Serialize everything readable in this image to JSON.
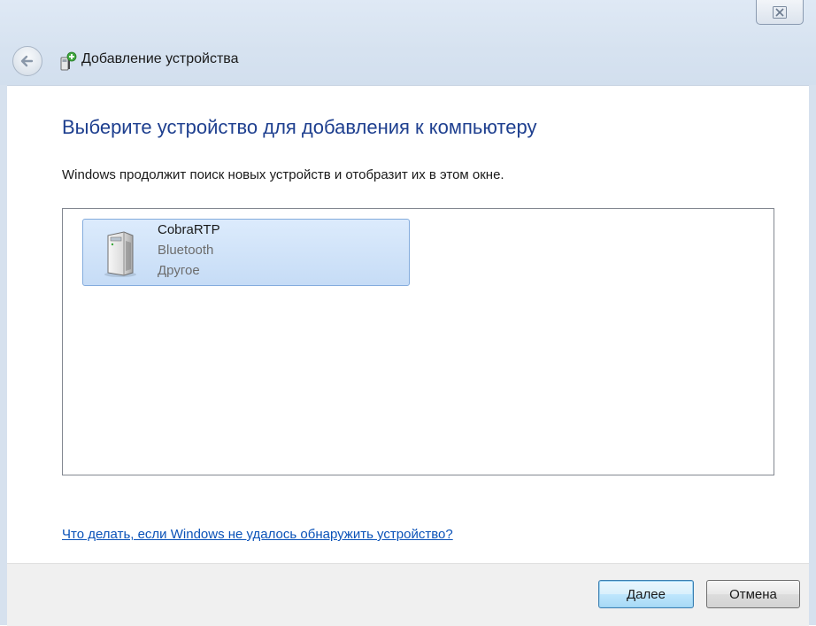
{
  "window": {
    "title": "Добавление устройства",
    "close_label": "☒"
  },
  "content": {
    "heading": "Выберите устройство для добавления к компьютеру",
    "subtext": "Windows продолжит поиск новых устройств и отобразит их в этом окне.",
    "devices": [
      {
        "name": "CobraRTP",
        "type": "Bluetooth",
        "category": "Другое",
        "icon": "device-tower-icon",
        "selected": true
      }
    ],
    "help_link": "Что делать, если Windows не удалось обнаружить устройство?"
  },
  "footer": {
    "next_label": "Далее",
    "cancel_label": "Отмена"
  },
  "colors": {
    "heading": "#1e3f8f",
    "link": "#0a52b8",
    "selection": "#c6dcf6"
  }
}
